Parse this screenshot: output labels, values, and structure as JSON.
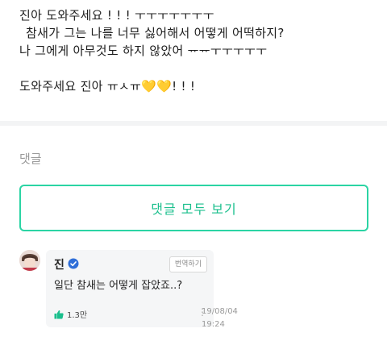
{
  "post": {
    "lines": [
      "진아 도와주세요 ! ! ! ㅜㅜㅜㅜㅜㅜㅜ",
      "참새가 그는 나를 너무 싫어해서 어떻게 어떡하지?",
      "나 그에게 아무것도 하지 않았어 ᅲᅲㅜㅜㅜㅜㅜ",
      "",
      "도와주세요 진아 ㅠㅅㅠ💛💛! ! !"
    ]
  },
  "comments": {
    "title": "댓글",
    "view_all_label": "댓글 모두 보기"
  },
  "comment": {
    "author": "진",
    "translate_label": "번역하기",
    "text": "일단 참새는 어떻게 잡았죠..?",
    "like_count": "1.3만",
    "more_label": "⋮",
    "date": "19/08/04",
    "time": "19:24"
  },
  "colors": {
    "accent": "#2bd4a4",
    "accent_text": "#1bbf8d",
    "verified": "#2f6ed8",
    "like": "#1bbf8d"
  },
  "icons": {
    "verified": "verified-check-icon",
    "like": "thumbs-up-icon",
    "more": "more-vertical-icon"
  }
}
